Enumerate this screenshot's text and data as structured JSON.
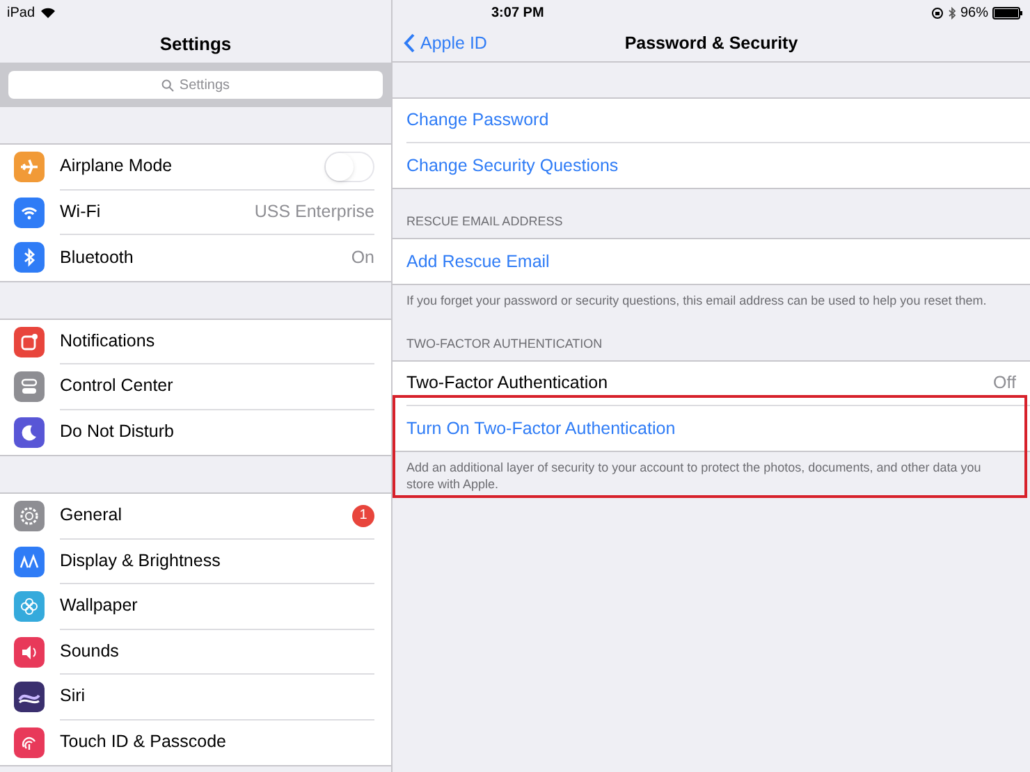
{
  "status_bar": {
    "device": "iPad",
    "time": "3:07 PM",
    "battery": "96%"
  },
  "sidebar": {
    "title": "Settings",
    "search": {
      "placeholder": "Settings"
    },
    "groups": [
      [
        {
          "label": "Airplane Mode",
          "color": "#f19a37",
          "kind": "toggle",
          "on": false
        },
        {
          "label": "Wi-Fi",
          "color": "#2f7cf6",
          "kind": "value",
          "value": "USS Enterprise"
        },
        {
          "label": "Bluetooth",
          "color": "#2f7cf6",
          "kind": "value",
          "value": "On"
        }
      ],
      [
        {
          "label": "Notifications",
          "color": "#e8453c",
          "kind": "plain"
        },
        {
          "label": "Control Center",
          "color": "#8e8e93",
          "kind": "plain"
        },
        {
          "label": "Do Not Disturb",
          "color": "#5856d6",
          "kind": "plain"
        }
      ],
      [
        {
          "label": "General",
          "color": "#8e8e93",
          "kind": "badge",
          "badge": "1"
        },
        {
          "label": "Display & Brightness",
          "color": "#2f7cf6",
          "kind": "plain"
        },
        {
          "label": "Wallpaper",
          "color": "#35aadc",
          "kind": "plain"
        },
        {
          "label": "Sounds",
          "color": "#e8395a",
          "kind": "plain"
        },
        {
          "label": "Siri",
          "color": "#3a2f6e",
          "kind": "plain"
        },
        {
          "label": "Touch ID & Passcode",
          "color": "#e8395a",
          "kind": "plain"
        }
      ]
    ]
  },
  "detail": {
    "back": "Apple ID",
    "title": "Password & Security",
    "sections": [
      {
        "rows": [
          {
            "label": "Change Password",
            "kind": "link"
          },
          {
            "label": "Change Security Questions",
            "kind": "link"
          }
        ]
      },
      {
        "header": "RESCUE EMAIL ADDRESS",
        "rows": [
          {
            "label": "Add Rescue Email",
            "kind": "link"
          }
        ],
        "footer": "If you forget your password or security questions, this email address can be used to help you reset them."
      },
      {
        "header": "TWO-FACTOR AUTHENTICATION",
        "rows": [
          {
            "label": "Two-Factor Authentication",
            "kind": "value",
            "value": "Off"
          },
          {
            "label": "Turn On Two-Factor Authentication",
            "kind": "link",
            "highlighted": true
          }
        ],
        "footer": "Add an additional layer of security to your account to protect the photos, documents, and other data you store with Apple."
      }
    ]
  }
}
